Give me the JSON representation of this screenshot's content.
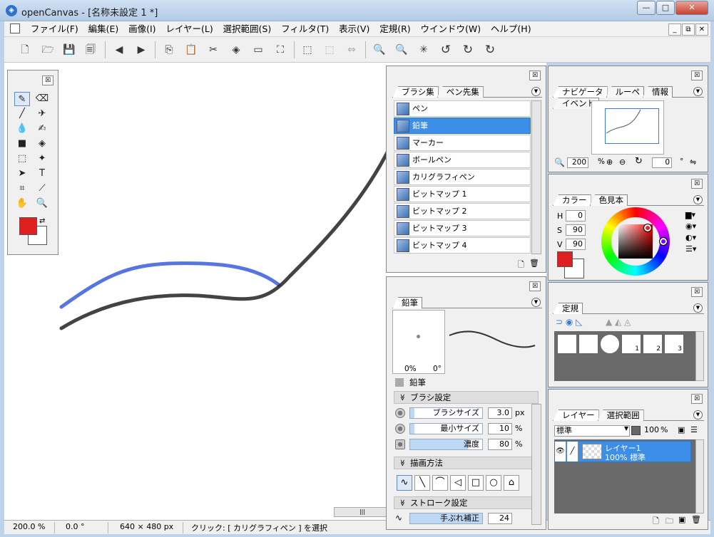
{
  "window": {
    "title": "openCanvas - [名称未設定 1 *]",
    "min": "—",
    "max": "□",
    "close": "✕"
  },
  "menu": {
    "items": [
      "ファイル(F)",
      "編集(E)",
      "画像(I)",
      "レイヤー(L)",
      "選択範囲(S)",
      "フィルタ(T)",
      "表示(V)",
      "定規(R)",
      "ウインドウ(W)",
      "ヘルプ(H)"
    ],
    "mdi_min": "_",
    "mdi_restore": "⧉",
    "mdi_close": "✕"
  },
  "toolbar": {
    "icons": [
      "new-file-icon",
      "open-folder-icon",
      "save-icon",
      "save-all-icon",
      "prev-icon",
      "next-icon",
      "copy-icon",
      "paste-icon",
      "cut-icon",
      "fill-icon",
      "eraser-icon",
      "transform-icon",
      "select-rect-icon",
      "select-clear-icon",
      "select-move-icon",
      "zoom-in-icon",
      "zoom-out-icon",
      "zoom-reset-icon",
      "rotate-left-icon",
      "rotate-right-icon",
      "rotate-reset-icon"
    ],
    "glyphs": [
      "🗋",
      "🗁",
      "💾",
      "🗐",
      "◀",
      "▶",
      "⎘",
      "📋",
      "✂",
      "◈",
      "▭",
      "⛶",
      "⬚",
      "⬚",
      "⇔",
      "🔍",
      "🔍",
      "✳",
      "↺",
      "↻",
      "↻"
    ]
  },
  "status": {
    "zoom": "200.0 %",
    "angle": "0.0 °",
    "size": "640 × 480 px",
    "message": "クリック: [ カリグラフィペン ] を選択"
  },
  "brush_panel": {
    "tabs": [
      "ブラシ集",
      "ペン先集"
    ],
    "close": "☒",
    "selected": 1,
    "items": [
      "ペン",
      "鉛筆",
      "マーカー",
      "ボールペン",
      "カリグラフィペン",
      "ビットマップ 1",
      "ビットマップ 2",
      "ビットマップ 3",
      "ビットマップ 4"
    ]
  },
  "pencil_panel": {
    "tab": "鉛筆",
    "close": "☒",
    "preview_pct": "0%",
    "preview_deg": "0°",
    "name": "鉛筆",
    "section_brush": "ブラシ設定",
    "brush_size_label": "ブラシサイズ",
    "brush_size_value": "3.0",
    "brush_size_unit": "px",
    "min_size_label": "最小サイズ",
    "min_size_value": "10",
    "min_size_unit": "%",
    "density_label": "濃度",
    "density_value": "80",
    "density_unit": "%",
    "section_draw": "描画方法",
    "section_stroke": "ストローク設定",
    "stabilizer_label": "手ぶれ補正",
    "stabilizer_value": "24"
  },
  "nav_panel": {
    "tabs": [
      "ナビゲータ",
      "ルーペ",
      "情報",
      "イベント"
    ],
    "close": "☒",
    "zoom_value": "200",
    "zoom_unit": "%",
    "rotate_value": "0",
    "rotate_unit": "°"
  },
  "color_panel": {
    "tabs": [
      "カラー",
      "色見本"
    ],
    "close": "☒",
    "h_label": "H",
    "h_value": "0",
    "s_label": "S",
    "s_value": "90",
    "v_label": "V",
    "v_value": "90",
    "fg_color": "#e02020",
    "bg_color": "#ffffff"
  },
  "ruler_panel": {
    "tabs": [
      "定規"
    ],
    "close": "☒",
    "labels": [
      "1",
      "2",
      "3"
    ]
  },
  "layer_panel": {
    "tabs": [
      "レイヤー",
      "選択範囲"
    ],
    "close": "☒",
    "blend": "標準",
    "opacity": "100",
    "layer_name": "レイヤー1",
    "layer_info": "100% 標準"
  },
  "tools_panel": {
    "close": "☒",
    "fg_color": "#e02020",
    "bg_color": "#ffffff"
  }
}
